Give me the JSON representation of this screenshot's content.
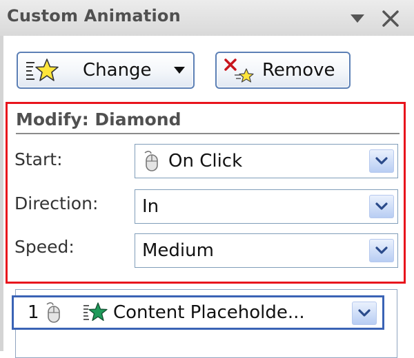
{
  "pane": {
    "title": "Custom Animation"
  },
  "toolbar": {
    "change_label": "Change",
    "remove_label": "Remove"
  },
  "modify": {
    "heading": "Modify: Diamond",
    "start": {
      "label": "Start:",
      "value": "On Click"
    },
    "direction": {
      "label": "Direction:",
      "value": "In"
    },
    "speed": {
      "label": "Speed:",
      "value": "Medium"
    }
  },
  "animation_list": {
    "items": [
      {
        "number": "1",
        "text": "Content Placeholde..."
      }
    ]
  },
  "icons": {
    "change": "star-effect-icon",
    "remove": "remove-effect-icon",
    "start_trigger": "mouse-icon",
    "effect": "entrance-star-icon",
    "dropdown": "chevron-down-icon",
    "close": "close-icon"
  },
  "colors": {
    "highlight_border": "#e8141c",
    "button_border": "#5b7fb5",
    "selection_border": "#3a63b5",
    "dropdown_fill": "#b8cdf3"
  }
}
